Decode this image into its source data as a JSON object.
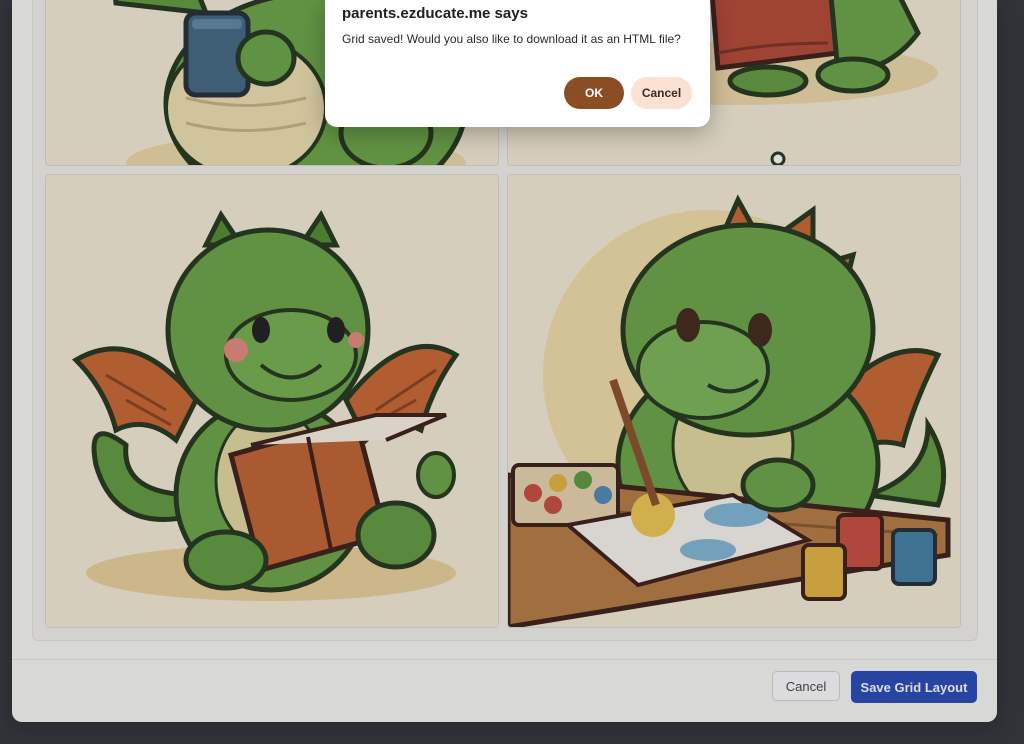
{
  "dialog": {
    "title": "parents.ezducate.me says",
    "message": "Grid saved! Would you also like to download it as an HTML file?",
    "ok_label": "OK",
    "cancel_label": "Cancel"
  },
  "grid": {
    "images": [
      {
        "icon": "dragon-holding-mug-image"
      },
      {
        "icon": "dragon-with-blanket-image"
      },
      {
        "icon": "dragon-reading-book-image"
      },
      {
        "icon": "dragon-painting-image"
      }
    ]
  },
  "footer": {
    "cancel_label": "Cancel",
    "save_label": "Save Grid Layout"
  },
  "colors": {
    "accent": "#2446b8",
    "dialog_ok": "#8b4e24",
    "dialog_cancel": "#fbe1d2",
    "dragon_green": "#5e9a3a",
    "wing_orange": "#c8642c"
  }
}
